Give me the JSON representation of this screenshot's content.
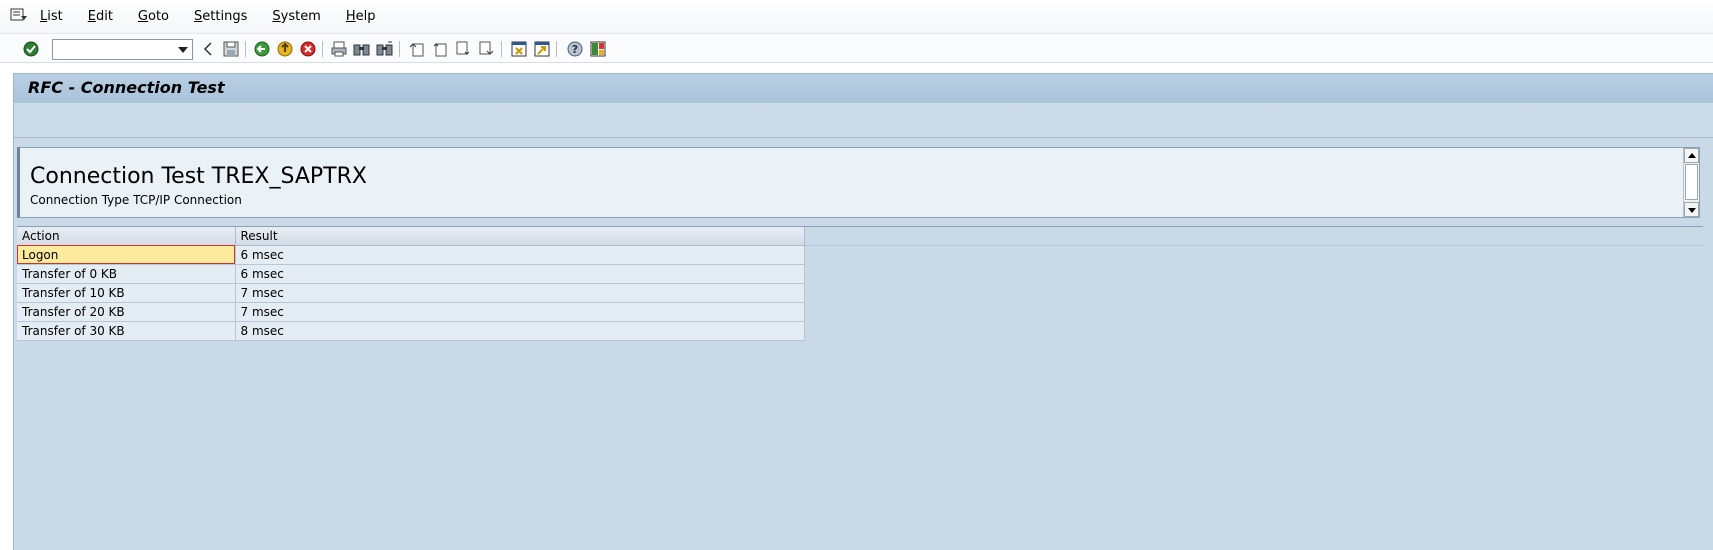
{
  "menubar": {
    "items": [
      {
        "label": "List",
        "underline": "L",
        "rest": "ist"
      },
      {
        "label": "Edit",
        "underline": "E",
        "rest": "dit"
      },
      {
        "label": "Goto",
        "underline": "G",
        "rest": "oto"
      },
      {
        "label": "Settings",
        "underline": "S",
        "rest": "ettings"
      },
      {
        "label": "System",
        "underline": "S",
        "rest": "ystem"
      },
      {
        "label": "Help",
        "underline": "H",
        "rest": "elp"
      }
    ]
  },
  "toolbar": {
    "command_field_value": "",
    "icons": [
      "enter-icon",
      "save-icon",
      "back-icon",
      "exit-icon",
      "cancel-icon",
      "print-icon",
      "find-icon",
      "find-next-icon",
      "first-page-icon",
      "previous-page-icon",
      "next-page-icon",
      "last-page-icon",
      "create-session-icon",
      "shortcut-icon",
      "help-icon",
      "layout-icon"
    ]
  },
  "title": {
    "text": "RFC - Connection Test"
  },
  "header": {
    "title": "Connection Test TREX_SAPTRX",
    "subtitle": "Connection Type TCP/IP Connection"
  },
  "table": {
    "columns": [
      "Action",
      "Result"
    ],
    "rows": [
      {
        "action": "Logon",
        "result": "6 msec"
      },
      {
        "action": "Transfer of 0 KB",
        "result": "6 msec"
      },
      {
        "action": "Transfer of 10 KB",
        "result": "7 msec"
      },
      {
        "action": "Transfer of 20 KB",
        "result": "7 msec"
      },
      {
        "action": "Transfer of 30 KB",
        "result": "8 msec"
      }
    ]
  },
  "colors": {
    "title_bar": "#b9cfe3",
    "content_bg": "#c9d9e7",
    "selected_cell": "#fdeb9d"
  }
}
